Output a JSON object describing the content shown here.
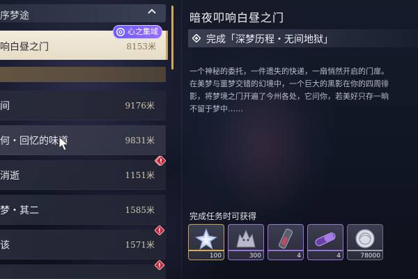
{
  "category": {
    "title": "序梦途",
    "tag_label": "心之集域"
  },
  "selected_quest": {
    "name": "响白昼之门",
    "distance": "8153米"
  },
  "quest_list": [
    {
      "name": "间",
      "distance": "9176米",
      "alert": false
    },
    {
      "name": "何・回忆的味道",
      "distance": "9831米",
      "alert": true
    },
    {
      "name": "消逝",
      "distance": "1151米",
      "alert": true
    },
    {
      "name": "梦・其二",
      "distance": "1585米",
      "alert": false
    },
    {
      "name": "该",
      "distance": "1571米",
      "alert": true
    }
  ],
  "detail": {
    "title": "暗夜叩响白昼之门",
    "objective": "完成「深梦历程・无间地狱」",
    "description": "一个神秘的委托，一件遗失的快递，一扇悄然开启的门扉。\n在美梦与噩梦交错的幻境中，一个巨大的黑影在你的四周徘\n影，将梦境之门开遍了今州各处，它问你，若美好只存一晌\n不留于梦中……",
    "reward_title": "完成任务时可获得",
    "rewards": [
      {
        "icon": "star-crystal-icon",
        "quantity": "100",
        "rarity": "gold"
      },
      {
        "icon": "wolf-echo-icon",
        "quantity": "300",
        "rarity": "purple"
      },
      {
        "icon": "tube-potion-icon",
        "quantity": "4",
        "rarity": "purple"
      },
      {
        "icon": "capsule-icon",
        "quantity": "4",
        "rarity": "purple"
      },
      {
        "icon": "shell-coin-icon",
        "quantity": "78000",
        "rarity": "gray"
      }
    ]
  },
  "colors": {
    "accent_gold": "#c5a56a",
    "tag_purple": "#7b62ff",
    "alert_red": "#c6283a"
  }
}
